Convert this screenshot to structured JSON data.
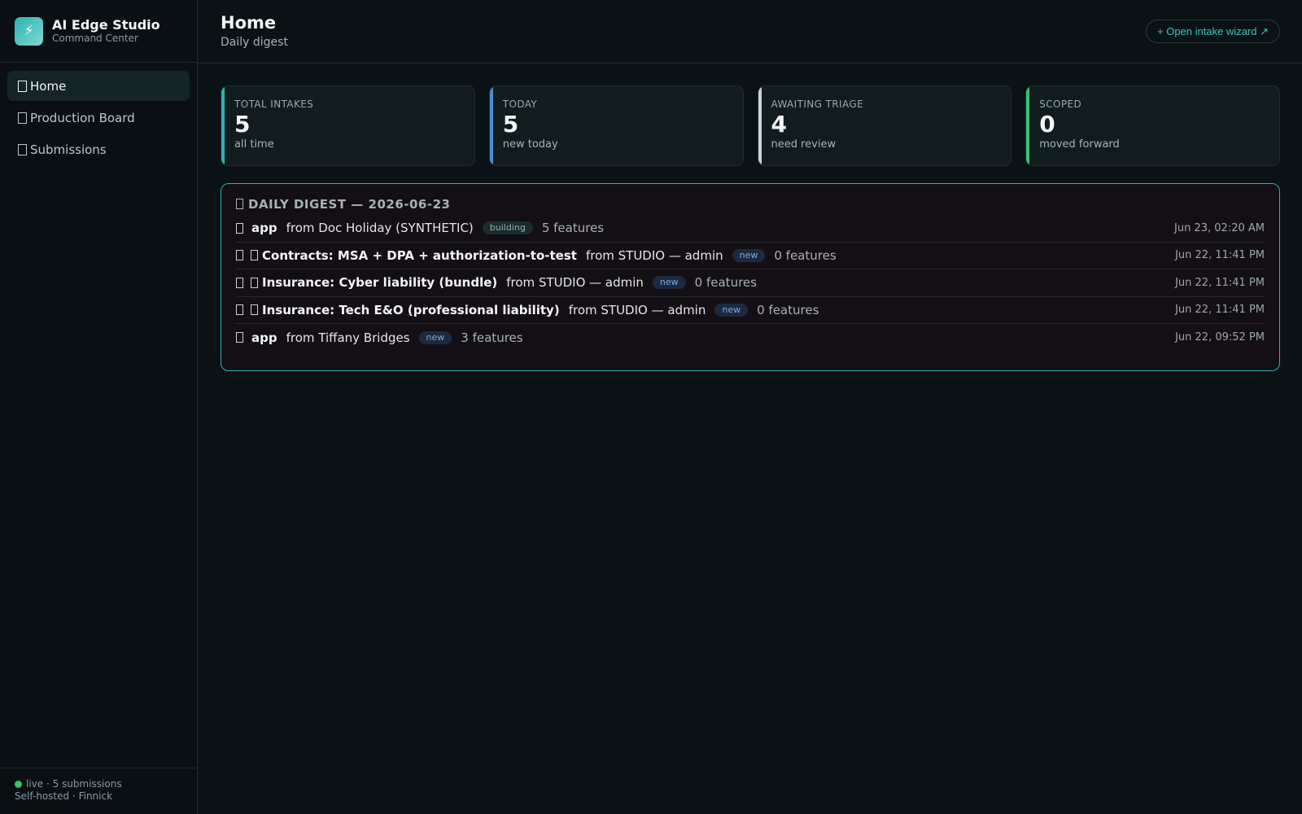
{
  "brand": {
    "title": "AI Edge Studio",
    "subtitle": "Command Center",
    "logo_icon": "⚡"
  },
  "nav": [
    {
      "label": "Home",
      "active": true
    },
    {
      "label": "Production Board",
      "active": false
    },
    {
      "label": "Submissions",
      "active": false
    }
  ],
  "footer": {
    "status": "live · 5 submissions",
    "host": "Self-hosted · Finnick",
    "status_color": "#35c36b"
  },
  "header": {
    "title": "Home",
    "subtitle": "Daily digest",
    "wizard_button": "+ Open intake wizard ↗"
  },
  "stats": [
    {
      "label": "TOTAL INTAKES",
      "value": "5",
      "sub": "all time",
      "accent": "#2bb3b1"
    },
    {
      "label": "TODAY",
      "value": "5",
      "sub": "new today",
      "accent": "#4a8fd6"
    },
    {
      "label": "AWAITING TRIAGE",
      "value": "4",
      "sub": "need review",
      "accent": "#c8d2d8"
    },
    {
      "label": "SCOPED",
      "value": "0",
      "sub": "moved forward",
      "accent": "#35c36b"
    }
  ],
  "digest": {
    "title": "DAILY DIGEST — 2026-06-23",
    "rows": [
      {
        "title": "app",
        "from": "from Doc Holiday (SYNTHETIC)",
        "badge": "building",
        "features": "5 features",
        "time": "Jun 23, 02:20 AM"
      },
      {
        "title": "Contracts: MSA + DPA + authorization-to-test",
        "from": "from STUDIO — admin",
        "badge": "new",
        "features": "0 features",
        "time": "Jun 22, 11:41 PM"
      },
      {
        "title": "Insurance: Cyber liability (bundle)",
        "from": "from STUDIO — admin",
        "badge": "new",
        "features": "0 features",
        "time": "Jun 22, 11:41 PM"
      },
      {
        "title": "Insurance: Tech E&O (professional liability)",
        "from": "from STUDIO — admin",
        "badge": "new",
        "features": "0 features",
        "time": "Jun 22, 11:41 PM"
      },
      {
        "title": "app",
        "from": "from Tiffany Bridges",
        "badge": "new",
        "features": "3 features",
        "time": "Jun 22, 09:52 PM"
      }
    ]
  }
}
